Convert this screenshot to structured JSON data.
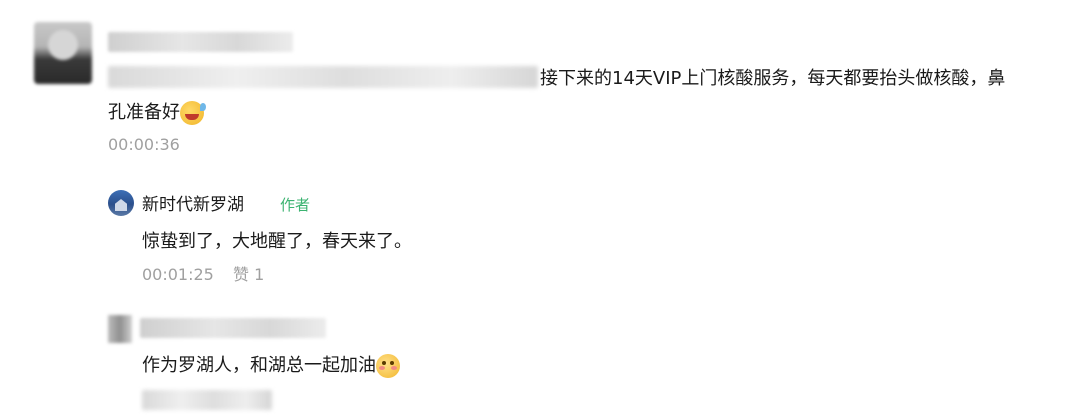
{
  "comments": {
    "first": {
      "text_part1": "接下来的14天VIP上门核酸服务，每天都要抬头做核酸，鼻",
      "text_part2": "孔准备好",
      "emoji": "sweat-smile-icon",
      "time": "00:00:36"
    },
    "reply": {
      "author": "新时代新罗湖",
      "author_tag": "作者",
      "text": "惊蛰到了，大地醒了，春天来了。",
      "time": "00:01:25",
      "likes_label": "赞 1"
    },
    "second": {
      "text": "作为罗湖人，和湖总一起加油",
      "emoji": "shy-smile-icon"
    }
  },
  "colors": {
    "author_tag": "#3cb371",
    "meta": "#a0a0a0",
    "text": "#1a1a1a"
  }
}
